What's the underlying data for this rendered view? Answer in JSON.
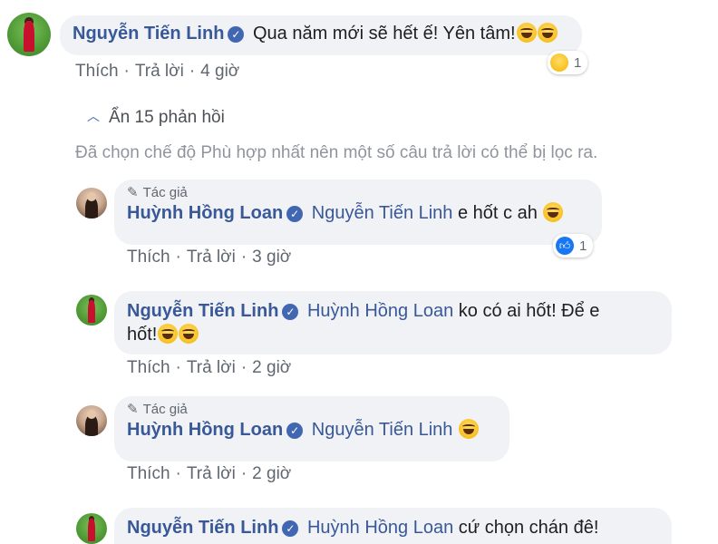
{
  "top_comment": {
    "author": "Nguyễn Tiến Linh",
    "text": "Qua năm mới sẽ hết ế! Yên tâm!",
    "emojis": [
      "rolling-on-floor-laughing",
      "rolling-on-floor-laughing"
    ],
    "actions": {
      "like": "Thích",
      "reply": "Trả lời",
      "time": "4 giờ"
    },
    "reaction": {
      "icon": "haha",
      "count": "1"
    }
  },
  "hide_replies": "Ẩn 15 phản hồi",
  "filter_note": "Đã chọn chế độ Phù hợp nhất nên một số câu trả lời có thể bị lọc ra.",
  "author_badge": "Tác giả",
  "replies": [
    {
      "author": "Huỳnh Hồng Loan",
      "author_tag": true,
      "mention": "Nguyễn Tiến Linh",
      "text": "e hốt c ah",
      "actions": {
        "like": "Thích",
        "reply": "Trả lời",
        "time": "3 giờ"
      },
      "reaction": {
        "icon": "like",
        "count": "1"
      }
    },
    {
      "author": "Nguyễn Tiến Linh",
      "mention": "Huỳnh Hồng Loan",
      "text": "ko có ai hốt! Để e",
      "text_line2": "hốt!",
      "actions": {
        "like": "Thích",
        "reply": "Trả lời",
        "time": "2 giờ"
      }
    },
    {
      "author": "Huỳnh Hồng Loan",
      "author_tag": true,
      "mention": "Nguyễn Tiến Linh",
      "actions": {
        "like": "Thích",
        "reply": "Trả lời",
        "time": "2 giờ"
      }
    },
    {
      "author": "Nguyễn Tiến Linh",
      "mention": "Huỳnh Hồng Loan",
      "text": "cứ chọn chán đê!"
    }
  ],
  "colors": {
    "name": "#385898",
    "bubble_bg": "#f0f2f5",
    "muted": "#606770",
    "verified": "#4267b2"
  },
  "icons": {
    "verified": "check-circle-icon",
    "author": "pencil-icon",
    "collapse": "chevron-up-icon"
  }
}
